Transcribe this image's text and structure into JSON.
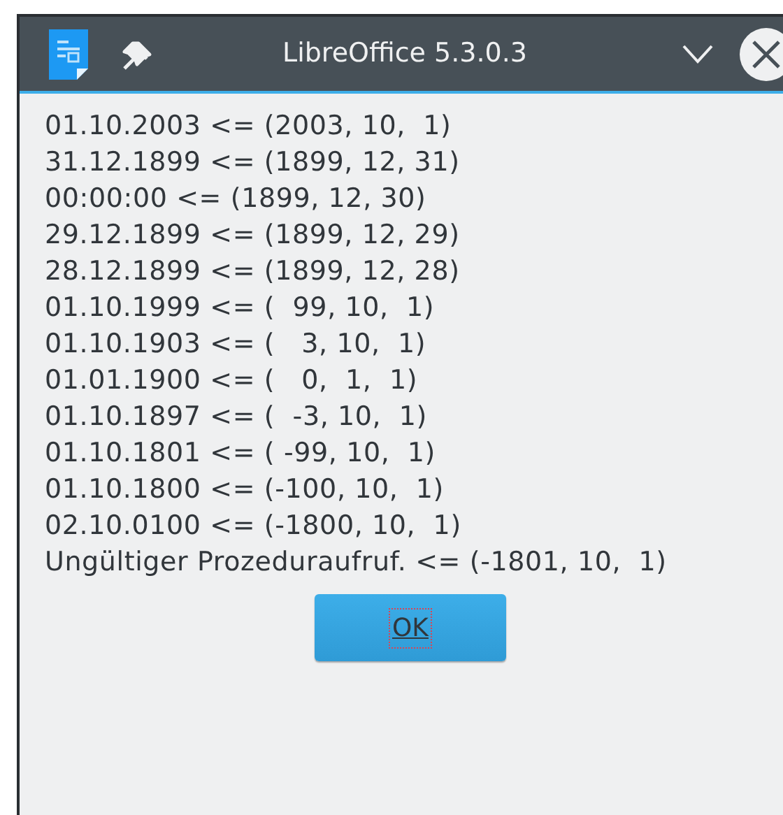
{
  "window": {
    "title": "LibreOffice 5.3.0.3"
  },
  "lines": [
    "01.10.2003 <= (2003, 10,  1)",
    "31.12.1899 <= (1899, 12, 31)",
    "00:00:00 <= (1899, 12, 30)",
    "29.12.1899 <= (1899, 12, 29)",
    "28.12.1899 <= (1899, 12, 28)",
    "01.10.1999 <= (  99, 10,  1)",
    "01.10.1903 <= (   3, 10,  1)",
    "01.01.1900 <= (   0,  1,  1)",
    "01.10.1897 <= (  -3, 10,  1)",
    "01.10.1801 <= ( -99, 10,  1)",
    "01.10.1800 <= (-100, 10,  1)",
    "02.10.0100 <= (-1800, 10,  1)",
    "Ungültiger Prozeduraufruf. <= (-1801, 10,  1)"
  ],
  "buttons": [
    {
      "label": "OK",
      "focused": true
    }
  ]
}
